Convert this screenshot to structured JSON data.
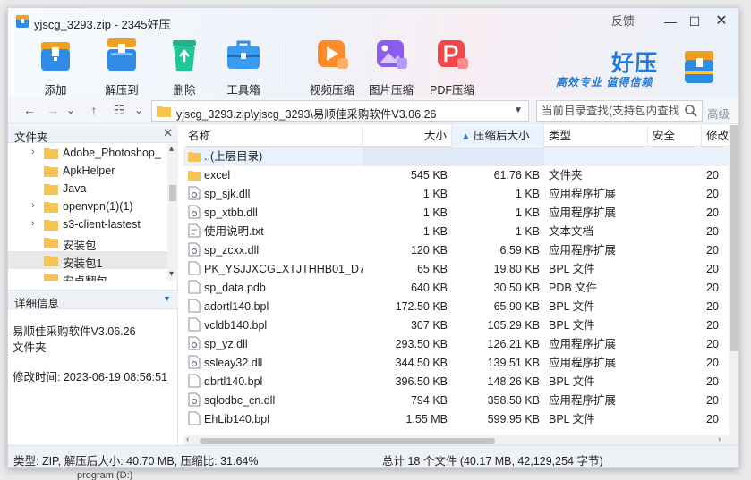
{
  "window": {
    "title": "yjscg_3293.zip - 2345好压",
    "feedback": "反馈",
    "controls": {
      "minimize": "—",
      "maximize": "☐",
      "close": "✕"
    }
  },
  "toolbar": {
    "add": "添加",
    "extract_to": "解压到",
    "delete": "删除",
    "toolbox": "工具箱",
    "video_compress": "视频压缩",
    "image_compress": "图片压缩",
    "pdf_compress": "PDF压缩"
  },
  "brand": {
    "name": "好压",
    "slogan": "高效专业  值得信赖"
  },
  "address": {
    "path": "yjscg_3293.zip\\yjscg_3293\\易顺佳采购软件V3.06.26",
    "search_placeholder": "当前目录查找(支持包内查找)",
    "advanced": "高级",
    "nav": {
      "back": "←",
      "forward": "→",
      "dropdown": "⌄",
      "up": "↑",
      "view": "☷",
      "view_dropdown": "⌄"
    }
  },
  "left_panel": {
    "folder_header": "文件夹",
    "close": "✕",
    "tree": [
      {
        "name": "Adobe_Photoshop_",
        "arrow": "›"
      },
      {
        "name": "ApkHelper",
        "arrow": ""
      },
      {
        "name": "Java",
        "arrow": ""
      },
      {
        "name": "openvpn(1)(1)",
        "arrow": "›"
      },
      {
        "name": "s3-client-lastest",
        "arrow": "›"
      },
      {
        "name": "安装包",
        "arrow": ""
      },
      {
        "name": "安装包1",
        "arrow": "",
        "selected": true
      },
      {
        "name": "安卓翻包",
        "arrow": ""
      }
    ],
    "detail_header": "详细信息",
    "detail_name": "易顺佳采购软件V3.06.26",
    "detail_type": "文件夹",
    "detail_modified": "修改时间: 2023-06-19 08:56:51"
  },
  "filelist": {
    "columns": {
      "name": "名称",
      "size": "大小",
      "compressed": "压缩后大小",
      "type": "类型",
      "security": "安全",
      "modified": "修改"
    },
    "parent_label": "..(上层目录)",
    "rows": [
      {
        "name": "excel",
        "size": "545 KB",
        "compressed": "61.76 KB",
        "type": "文件夹",
        "modified": "20",
        "icon": "folder"
      },
      {
        "name": "sp_sjk.dll",
        "size": "1 KB",
        "compressed": "1 KB",
        "type": "应用程序扩展",
        "modified": "20",
        "icon": "dll"
      },
      {
        "name": "sp_xtbb.dll",
        "size": "1 KB",
        "compressed": "1 KB",
        "type": "应用程序扩展",
        "modified": "20",
        "icon": "dll"
      },
      {
        "name": "使用说明.txt",
        "size": "1 KB",
        "compressed": "1 KB",
        "type": "文本文档",
        "modified": "20",
        "icon": "txt"
      },
      {
        "name": "sp_zcxx.dll",
        "size": "120 KB",
        "compressed": "6.59 KB",
        "type": "应用程序扩展",
        "modified": "20",
        "icon": "dll"
      },
      {
        "name": "PK_YSJJXCGLXTJTHHB01_D7...",
        "size": "65 KB",
        "compressed": "19.80 KB",
        "type": "BPL 文件",
        "modified": "20",
        "icon": "file"
      },
      {
        "name": "sp_data.pdb",
        "size": "640 KB",
        "compressed": "30.50 KB",
        "type": "PDB 文件",
        "modified": "20",
        "icon": "file"
      },
      {
        "name": "adortl140.bpl",
        "size": "172.50 KB",
        "compressed": "65.90 KB",
        "type": "BPL 文件",
        "modified": "20",
        "icon": "file"
      },
      {
        "name": "vcldb140.bpl",
        "size": "307 KB",
        "compressed": "105.29 KB",
        "type": "BPL 文件",
        "modified": "20",
        "icon": "file"
      },
      {
        "name": "sp_yz.dll",
        "size": "293.50 KB",
        "compressed": "126.21 KB",
        "type": "应用程序扩展",
        "modified": "20",
        "icon": "dll"
      },
      {
        "name": "ssleay32.dll",
        "size": "344.50 KB",
        "compressed": "139.51 KB",
        "type": "应用程序扩展",
        "modified": "20",
        "icon": "dll"
      },
      {
        "name": "dbrtl140.bpl",
        "size": "396.50 KB",
        "compressed": "148.26 KB",
        "type": "BPL 文件",
        "modified": "20",
        "icon": "file"
      },
      {
        "name": "sqlodbc_cn.dll",
        "size": "794 KB",
        "compressed": "358.50 KB",
        "type": "应用程序扩展",
        "modified": "20",
        "icon": "dll"
      },
      {
        "name": "EhLib140.bpl",
        "size": "1.55 MB",
        "compressed": "599.95 KB",
        "type": "BPL 文件",
        "modified": "20",
        "icon": "file"
      }
    ]
  },
  "status": {
    "left": "类型: ZIP, 解压后大小: 40.70 MB, 压缩比: 31.64%",
    "right": "总计 18 个文件 (40.17 MB, 42,129,254 字节)"
  },
  "background_text": "program (D:)",
  "colors": {
    "accent": "#1f7ad8",
    "folder": "#f5c451",
    "selection": "#e9f1fc"
  }
}
